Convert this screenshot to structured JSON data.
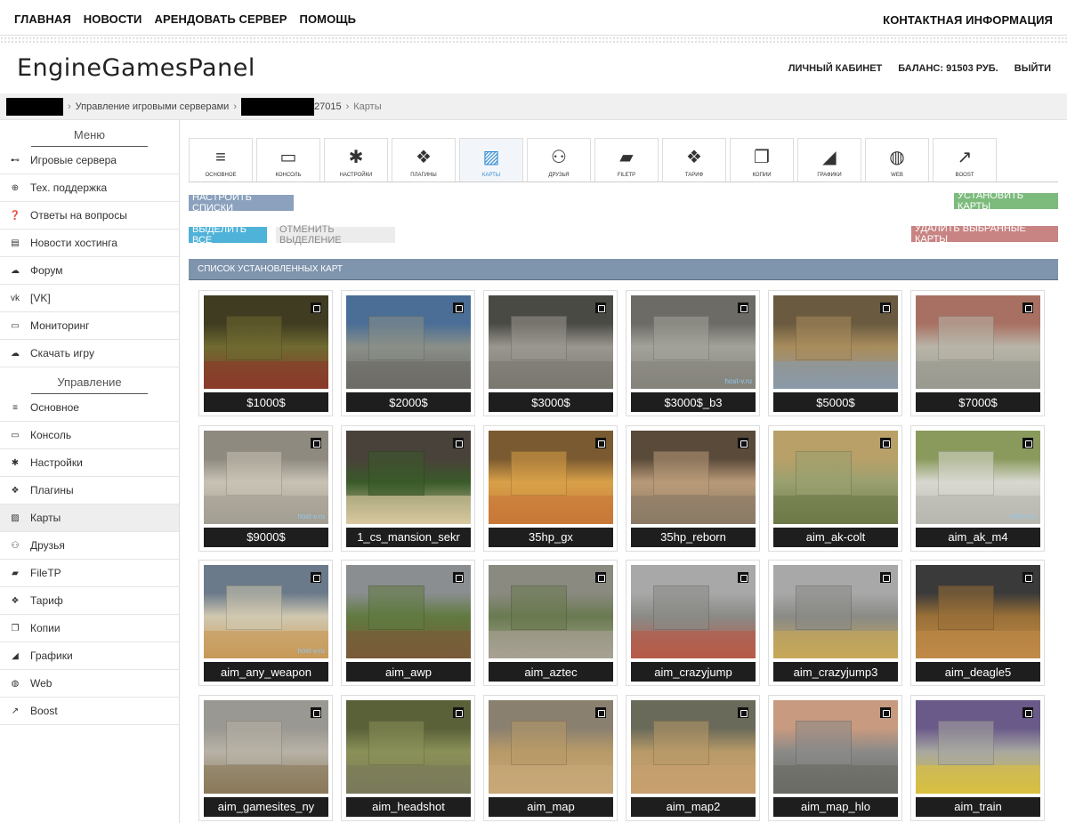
{
  "topnav": {
    "items": [
      "ГЛАВНАЯ",
      "НОВОСТИ",
      "АРЕНДОВАТЬ СЕРВЕР",
      "ПОМОЩЬ"
    ],
    "contact": "КОНТАКТНАЯ ИНФОРМАЦИЯ"
  },
  "header": {
    "logo": "EngineGamesPanel",
    "cabinet": "ЛИЧНЫЙ КАБИНЕТ",
    "balance": "БАЛАНС: 91503 РУБ.",
    "logout": "ВЫЙТИ"
  },
  "breadcrumb": {
    "item1": "Управление игровыми серверами",
    "item2_suffix": "27015",
    "item3": "Карты"
  },
  "sidebar": {
    "menu_title": "Меню",
    "menu_items": [
      {
        "label": "Игровые сервера",
        "icon": "gamepad-icon",
        "glyph": "⊷"
      },
      {
        "label": "Тех. поддержка",
        "icon": "lifebuoy-icon",
        "glyph": "⊕"
      },
      {
        "label": "Ответы на вопросы",
        "icon": "question-icon",
        "glyph": "❓"
      },
      {
        "label": "Новости хостинга",
        "icon": "newspaper-icon",
        "glyph": "▤"
      },
      {
        "label": "Форум",
        "icon": "comments-icon",
        "glyph": "☁"
      },
      {
        "label": "[VK]",
        "icon": "vk-icon",
        "glyph": "vk"
      },
      {
        "label": "Мониторинг",
        "icon": "monitor-icon",
        "glyph": "▭"
      },
      {
        "label": "Скачать игру",
        "icon": "cloud-download-icon",
        "glyph": "☁"
      }
    ],
    "manage_title": "Управление",
    "manage_items": [
      {
        "label": "Основное",
        "icon": "bars-icon",
        "glyph": "≡"
      },
      {
        "label": "Консоль",
        "icon": "desktop-icon",
        "glyph": "▭"
      },
      {
        "label": "Настройки",
        "icon": "gear-icon",
        "glyph": "✱"
      },
      {
        "label": "Плагины",
        "icon": "cubes-icon",
        "glyph": "❖"
      },
      {
        "label": "Карты",
        "icon": "image-icon",
        "glyph": "▨"
      },
      {
        "label": "Друзья",
        "icon": "user-plus-icon",
        "glyph": "⚇"
      },
      {
        "label": "FileTP",
        "icon": "folder-icon",
        "glyph": "▰"
      },
      {
        "label": "Тариф",
        "icon": "dropbox-icon",
        "glyph": "❖"
      },
      {
        "label": "Копии",
        "icon": "copy-icon",
        "glyph": "❐"
      },
      {
        "label": "Графики",
        "icon": "area-chart-icon",
        "glyph": "◢"
      },
      {
        "label": "Web",
        "icon": "globe-icon",
        "glyph": "◍"
      },
      {
        "label": "Boost",
        "icon": "line-chart-icon",
        "glyph": "↗"
      }
    ]
  },
  "tabs": [
    {
      "label": "ОСНОВНОЕ",
      "icon": "bars-icon",
      "glyph": "≡"
    },
    {
      "label": "КОНСОЛЬ",
      "icon": "desktop-icon",
      "glyph": "▭"
    },
    {
      "label": "НАСТРОЙКИ",
      "icon": "gear-icon",
      "glyph": "✱"
    },
    {
      "label": "ПЛАГИНЫ",
      "icon": "cubes-icon",
      "glyph": "❖"
    },
    {
      "label": "КАРТЫ",
      "icon": "image-icon",
      "glyph": "▨"
    },
    {
      "label": "ДРУЗЬЯ",
      "icon": "user-plus-icon",
      "glyph": "⚇"
    },
    {
      "label": "FILETP",
      "icon": "folder-icon",
      "glyph": "▰"
    },
    {
      "label": "ТАРИФ",
      "icon": "dropbox-icon",
      "glyph": "❖"
    },
    {
      "label": "КОПИИ",
      "icon": "copy-icon",
      "glyph": "❐"
    },
    {
      "label": "ГРАФИКИ",
      "icon": "area-chart-icon",
      "glyph": "◢"
    },
    {
      "label": "WEB",
      "icon": "globe-icon",
      "glyph": "◍"
    },
    {
      "label": "BOOST",
      "icon": "line-chart-icon",
      "glyph": "↗"
    }
  ],
  "actions": {
    "configure_lists": "НАСТРОИТЬ СПИСКИ",
    "install_maps": "УСТАНОВИТЬ КАРТЫ",
    "select_all": "ВЫДЕЛИТЬ ВСЕ",
    "deselect": "ОТМЕНИТЬ ВЫДЕЛЕНИЕ",
    "delete_selected": "УДАЛИТЬ ВЫБРАННЫЕ КАРТЫ"
  },
  "panel_title": "СПИСОК УСТАНОВЛЕННЫХ КАРТ",
  "watermark": "host-v.ru",
  "maps": [
    {
      "name": "$1000$",
      "colors": [
        "#3f3c22",
        "#6f6a30",
        "#8a3b2a"
      ]
    },
    {
      "name": "$2000$",
      "colors": [
        "#4a6e96",
        "#8a8f88",
        "#6c6a66"
      ]
    },
    {
      "name": "$3000$",
      "colors": [
        "#4a4a44",
        "#9a9790",
        "#7a7870"
      ],
      "wm": false
    },
    {
      "name": "$3000$_b3",
      "colors": [
        "#6c6b66",
        "#a3a29a",
        "#85847c"
      ],
      "wm": true
    },
    {
      "name": "$5000$",
      "colors": [
        "#6a5a40",
        "#a88c5c",
        "#8a9aa8"
      ]
    },
    {
      "name": "$7000$",
      "colors": [
        "#a87062",
        "#b8b4a8",
        "#9a9a90"
      ]
    },
    {
      "name": "$9000$",
      "colors": [
        "#8f8a80",
        "#c8c2b4",
        "#a39e92"
      ],
      "wm": true
    },
    {
      "name": "1_cs_mansion_sekr",
      "colors": [
        "#49423a",
        "#3a5a2a",
        "#d8c8a0"
      ]
    },
    {
      "name": "35hp_gx",
      "colors": [
        "#7a5a30",
        "#d8a048",
        "#c87838"
      ]
    },
    {
      "name": "35hp_reborn",
      "colors": [
        "#5a4a3a",
        "#b89a78",
        "#8a7a66"
      ]
    },
    {
      "name": "aim_ak-colt",
      "colors": [
        "#b8a068",
        "#9aa070",
        "#6c7a48"
      ]
    },
    {
      "name": "aim_ak_m4",
      "colors": [
        "#8a9a5c",
        "#d8d8d0",
        "#b8b8b0"
      ],
      "wm": true
    },
    {
      "name": "aim_any_weapon",
      "colors": [
        "#6a7a8a",
        "#d0c8b0",
        "#c89a58"
      ],
      "wm": true
    },
    {
      "name": "aim_awp",
      "colors": [
        "#8a8e90",
        "#607a40",
        "#7a5a38"
      ]
    },
    {
      "name": "aim_aztec",
      "colors": [
        "#8a8a80",
        "#6a7a50",
        "#a8a294"
      ]
    },
    {
      "name": "aim_crazyjump",
      "colors": [
        "#a8a8a8",
        "#8a8a86",
        "#b85a48"
      ]
    },
    {
      "name": "aim_crazyjump3",
      "colors": [
        "#a8a8a8",
        "#8a8a86",
        "#c8a858"
      ]
    },
    {
      "name": "aim_deagle5",
      "colors": [
        "#3a3a3a",
        "#9a7038",
        "#c08a48"
      ]
    },
    {
      "name": "aim_gamesites_ny",
      "colors": [
        "#9a9892",
        "#b8b2a6",
        "#8a7a5a"
      ]
    },
    {
      "name": "aim_headshot",
      "colors": [
        "#5a6038",
        "#8a9058",
        "#7a7a5a"
      ]
    },
    {
      "name": "aim_map",
      "colors": [
        "#8a8070",
        "#b89a68",
        "#c8a878"
      ]
    },
    {
      "name": "aim_map2",
      "colors": [
        "#6a6a5a",
        "#b89a68",
        "#c8a070"
      ]
    },
    {
      "name": "aim_map_hlo",
      "colors": [
        "#c89a80",
        "#8a8a88",
        "#6a6a64"
      ]
    },
    {
      "name": "aim_train",
      "colors": [
        "#6a5a8a",
        "#a8a8a0",
        "#d8c040"
      ]
    }
  ]
}
